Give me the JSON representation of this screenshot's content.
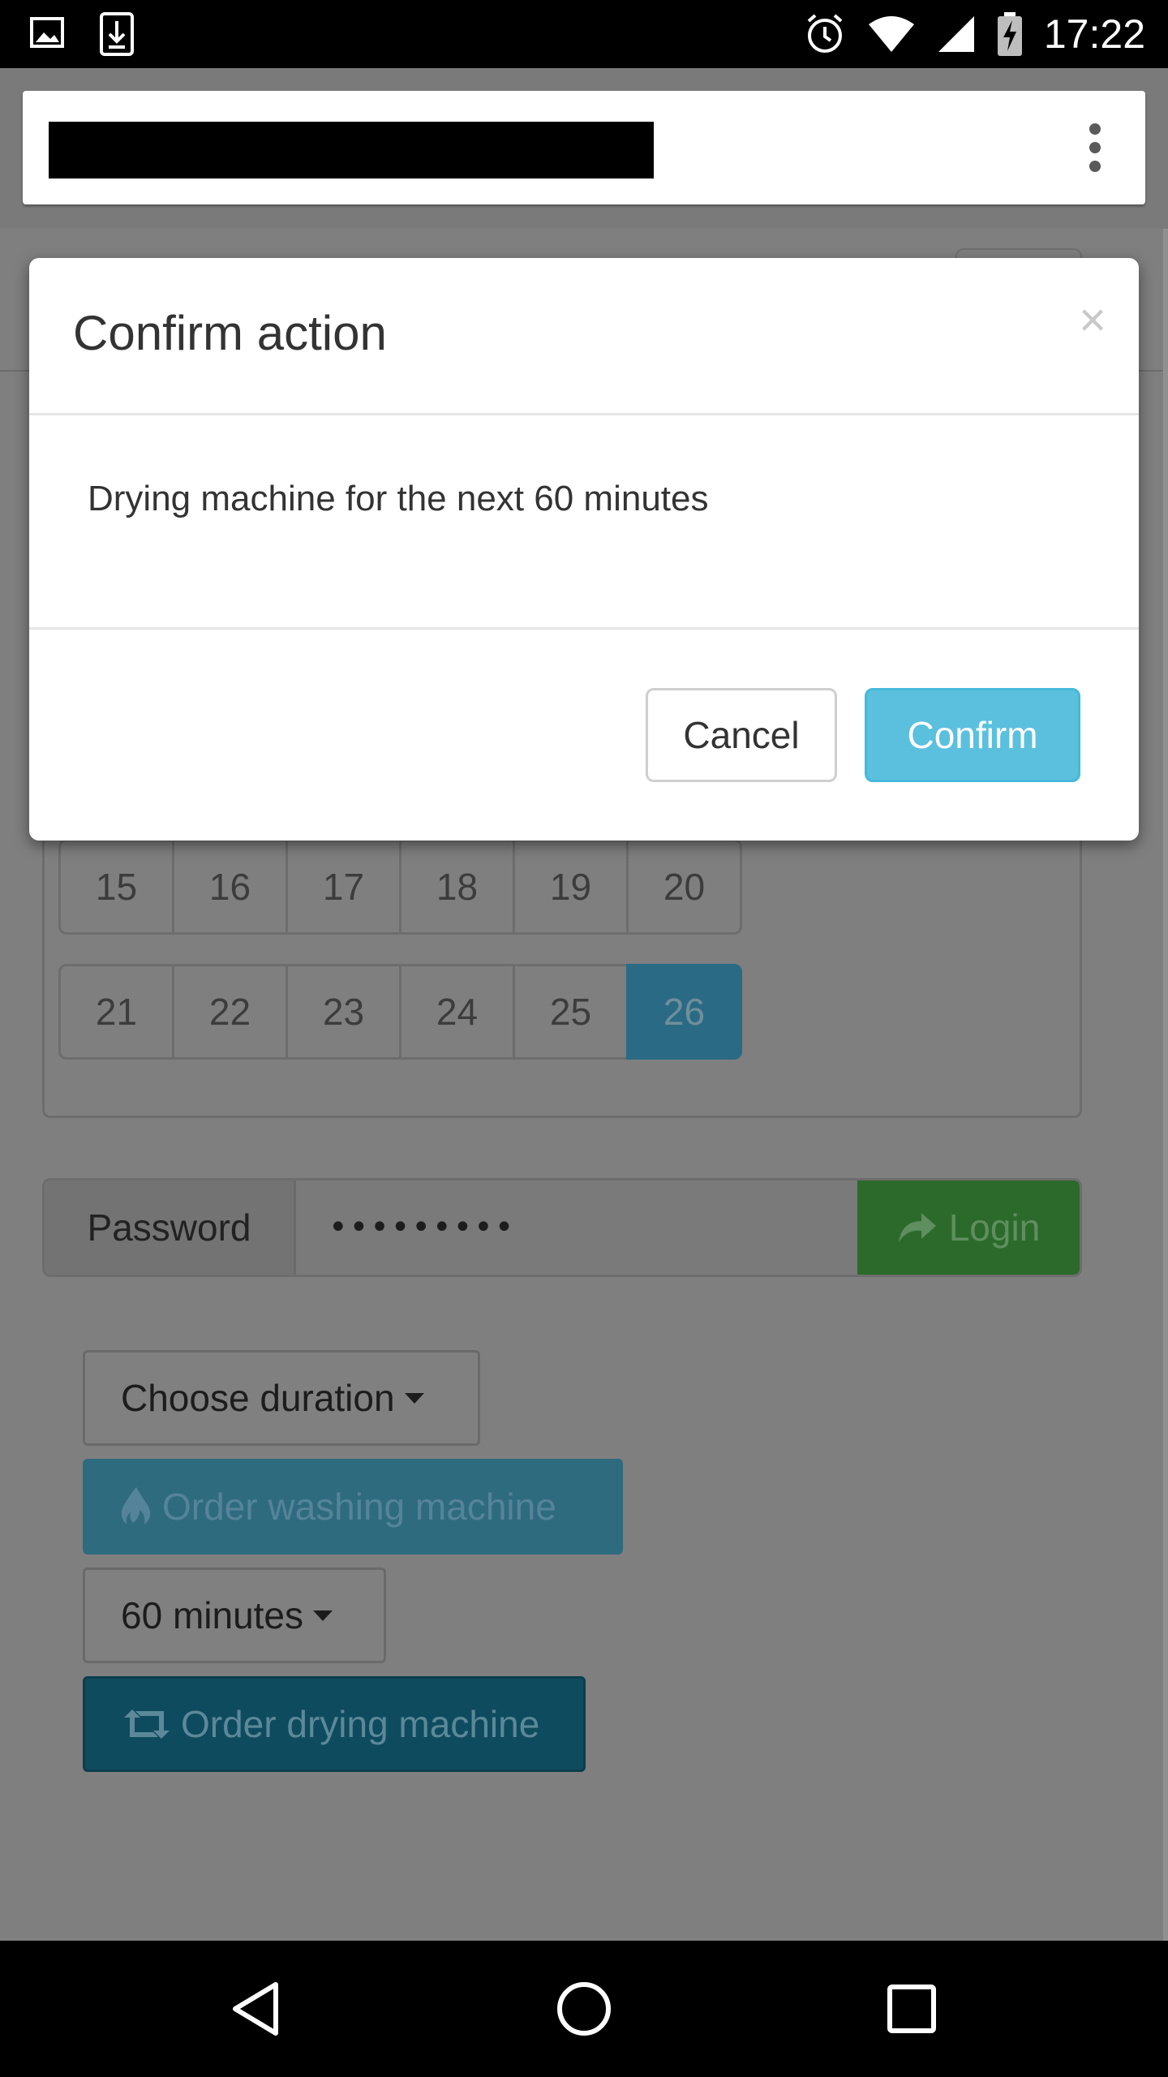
{
  "status_bar": {
    "time": "17:22",
    "icons": [
      "image-icon",
      "download-icon",
      "alarm-icon",
      "wifi-icon",
      "signal-icon",
      "battery-charging-icon"
    ]
  },
  "browser": {
    "menu_icon": "more-vert-icon"
  },
  "calendar": {
    "rows": [
      [
        "15",
        "16",
        "17",
        "18",
        "19",
        "20"
      ],
      [
        "21",
        "22",
        "23",
        "24",
        "25",
        "26"
      ]
    ],
    "selected_day": "26"
  },
  "login": {
    "label": "Password",
    "value": "•••••••••",
    "button_label": "Login",
    "button_icon": "share-arrow-icon"
  },
  "washing": {
    "duration_label": "Choose duration",
    "order_label": "Order washing machine",
    "order_icon": "fire-icon"
  },
  "drying": {
    "duration_label": "60 minutes",
    "order_label": "Order drying machine",
    "order_icon": "retweet-icon"
  },
  "modal": {
    "title": "Confirm action",
    "close_label": "×",
    "message": "Drying machine for the next 60 minutes",
    "cancel_label": "Cancel",
    "confirm_label": "Confirm"
  },
  "colors": {
    "confirm": "#5bc0de",
    "backdrop": "#808080",
    "login_success": "#2c6a2c",
    "selected_day": "#2a6a85"
  },
  "navigation_bar": {
    "icons": [
      "back-icon",
      "home-icon",
      "recents-icon"
    ]
  }
}
